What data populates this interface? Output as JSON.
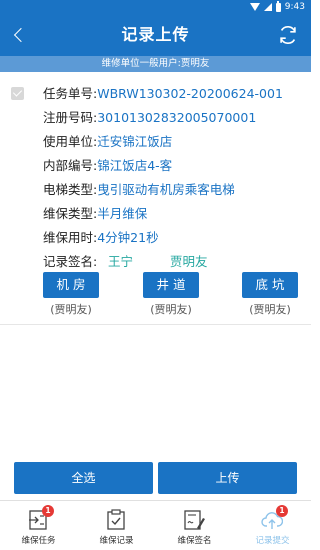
{
  "status_bar": {
    "time": "9:43",
    "bg_color": "#1a73c4"
  },
  "header": {
    "title": "记录上传",
    "back_icon": "chevron-left-icon",
    "refresh_icon": "refresh-icon"
  },
  "sub_header": {
    "text": "维修单位一般用户:贾明友",
    "bg_color": "#5c9ad6"
  },
  "record": {
    "checked": true,
    "fields": [
      {
        "label": "任务单号:",
        "value": "WBRW130302-20200624-001"
      },
      {
        "label": "注册号码:",
        "value": "30101302832005070001"
      },
      {
        "label": "使用单位:",
        "value": "迁安锦江饭店"
      },
      {
        "label": "内部编号:",
        "value": "锦江饭店4-客"
      },
      {
        "label": "电梯类型:",
        "value": "曳引驱动有机房乘客电梯"
      },
      {
        "label": "维保类型:",
        "value": "半月维保"
      },
      {
        "label": "维保用时:",
        "value": "4分钟21秒"
      }
    ],
    "signature": {
      "label": "记录签名:",
      "names": [
        "王宁",
        "贾明友"
      ]
    },
    "locations": [
      {
        "label": "机房",
        "person": "(贾明友)"
      },
      {
        "label": "井道",
        "person": "(贾明友)"
      },
      {
        "label": "底坑",
        "person": "(贾明友)"
      }
    ]
  },
  "actions": {
    "select_all": "全选",
    "upload": "上传"
  },
  "nav": [
    {
      "label": "维保任务",
      "icon": "task-list-icon",
      "badge": "1",
      "active": false
    },
    {
      "label": "维保记录",
      "icon": "clipboard-check-icon",
      "badge": "",
      "active": false
    },
    {
      "label": "维保签名",
      "icon": "signature-icon",
      "badge": "",
      "active": false
    },
    {
      "label": "记录提交",
      "icon": "cloud-upload-icon",
      "badge": "1",
      "active": true
    }
  ],
  "colors": {
    "primary": "#1a73c4",
    "value_text": "#1a73c4",
    "signature_text": "#25a7a0",
    "active_nav": "#8ec3ea",
    "badge": "#e53935"
  }
}
